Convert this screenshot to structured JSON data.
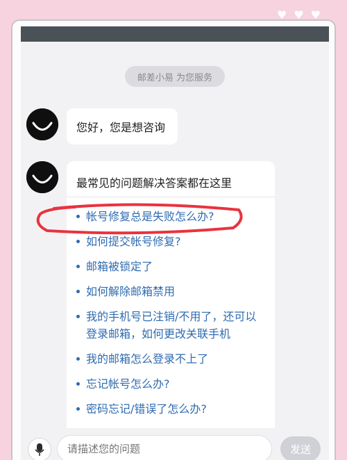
{
  "service_banner": "邮差小易 为您服务",
  "messages": {
    "greeting": "您好，您是想咨询",
    "faq_header": "最常见的问题解决答案都在这里"
  },
  "faq": [
    "帐号修复总是失败怎么办?",
    "如何提交帐号修复?",
    "邮箱被锁定了",
    "如何解除邮箱禁用",
    "我的手机号已注销/不用了，还可以登录邮箱，如何更改关联手机",
    "我的邮箱怎么登录不上了",
    "忘记帐号怎么办?",
    "密码忘记/错误了怎么办?"
  ],
  "input": {
    "placeholder": "请描述您的问题"
  },
  "send_label": "发送",
  "colors": {
    "link": "#2f6bb1",
    "annotation": "#e8333e",
    "background": "#f7d3df"
  }
}
